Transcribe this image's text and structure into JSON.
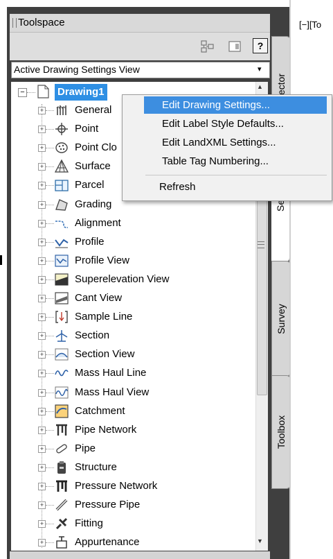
{
  "palette": {
    "window_bg": "#3f3f3f",
    "title_bg": "#d9d9d9",
    "selection": "#2e8fe4",
    "menu_highlight": "#3d8ee0"
  },
  "toolspace": {
    "title": "Toolspace",
    "help_label": "?",
    "view_select": {
      "value": "Active Drawing Settings View",
      "arrow": "▾"
    },
    "tabs": [
      {
        "label": "Prospector",
        "shown": "spector"
      },
      {
        "label": "Settings",
        "shown": "Setti"
      },
      {
        "label": "Survey",
        "shown": "Survey"
      },
      {
        "label": "Toolbox",
        "shown": "Toolbox"
      }
    ],
    "tree": {
      "root": {
        "label": "Drawing1",
        "expander": "⊟"
      },
      "items": [
        {
          "label": "General",
          "icon": "general-icon"
        },
        {
          "label": "Point",
          "icon": "point-icon"
        },
        {
          "label": "Point Clo",
          "icon": "point-cloud-icon"
        },
        {
          "label": "Surface",
          "icon": "surface-icon"
        },
        {
          "label": "Parcel",
          "icon": "parcel-icon"
        },
        {
          "label": "Grading",
          "icon": "grading-icon"
        },
        {
          "label": "Alignment",
          "icon": "alignment-icon"
        },
        {
          "label": "Profile",
          "icon": "profile-icon"
        },
        {
          "label": "Profile View",
          "icon": "profile-view-icon"
        },
        {
          "label": "Superelevation View",
          "icon": "superelevation-view-icon"
        },
        {
          "label": "Cant View",
          "icon": "cant-view-icon"
        },
        {
          "label": "Sample Line",
          "icon": "sample-line-icon"
        },
        {
          "label": "Section",
          "icon": "section-icon"
        },
        {
          "label": "Section View",
          "icon": "section-view-icon"
        },
        {
          "label": "Mass Haul Line",
          "icon": "mass-haul-line-icon"
        },
        {
          "label": "Mass Haul View",
          "icon": "mass-haul-view-icon"
        },
        {
          "label": "Catchment",
          "icon": "catchment-icon"
        },
        {
          "label": "Pipe Network",
          "icon": "pipe-network-icon"
        },
        {
          "label": "Pipe",
          "icon": "pipe-icon"
        },
        {
          "label": "Structure",
          "icon": "structure-icon"
        },
        {
          "label": "Pressure Network",
          "icon": "pressure-network-icon"
        },
        {
          "label": "Pressure Pipe",
          "icon": "pressure-pipe-icon"
        },
        {
          "label": "Fitting",
          "icon": "fitting-icon"
        },
        {
          "label": "Appurtenance",
          "icon": "appurtenance-icon"
        }
      ]
    }
  },
  "context_menu": {
    "items": [
      {
        "label": "Edit Drawing Settings...",
        "highlighted": true
      },
      {
        "label": "Edit Label Style Defaults..."
      },
      {
        "label": "Edit LandXML Settings..."
      },
      {
        "label": "Table Tag Numbering..."
      },
      {
        "label": "Refresh"
      }
    ]
  },
  "viewport": {
    "label": "[−][To"
  }
}
